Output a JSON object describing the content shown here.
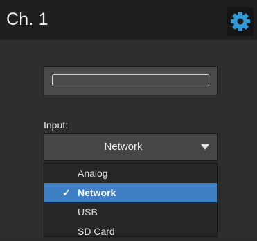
{
  "header": {
    "title": "Ch. 1",
    "settings_icon": "gear-icon",
    "accent_color": "#2f9bd9"
  },
  "input_section": {
    "label": "Input:",
    "selected_value": "Network",
    "dropdown_icon": "caret-down-icon",
    "options": [
      {
        "label": "Analog",
        "selected": false
      },
      {
        "label": "Network",
        "selected": true
      },
      {
        "label": "USB",
        "selected": false
      },
      {
        "label": "SD Card",
        "selected": false
      }
    ],
    "check_mark": "✓",
    "highlight_color": "#3f7fc4"
  }
}
